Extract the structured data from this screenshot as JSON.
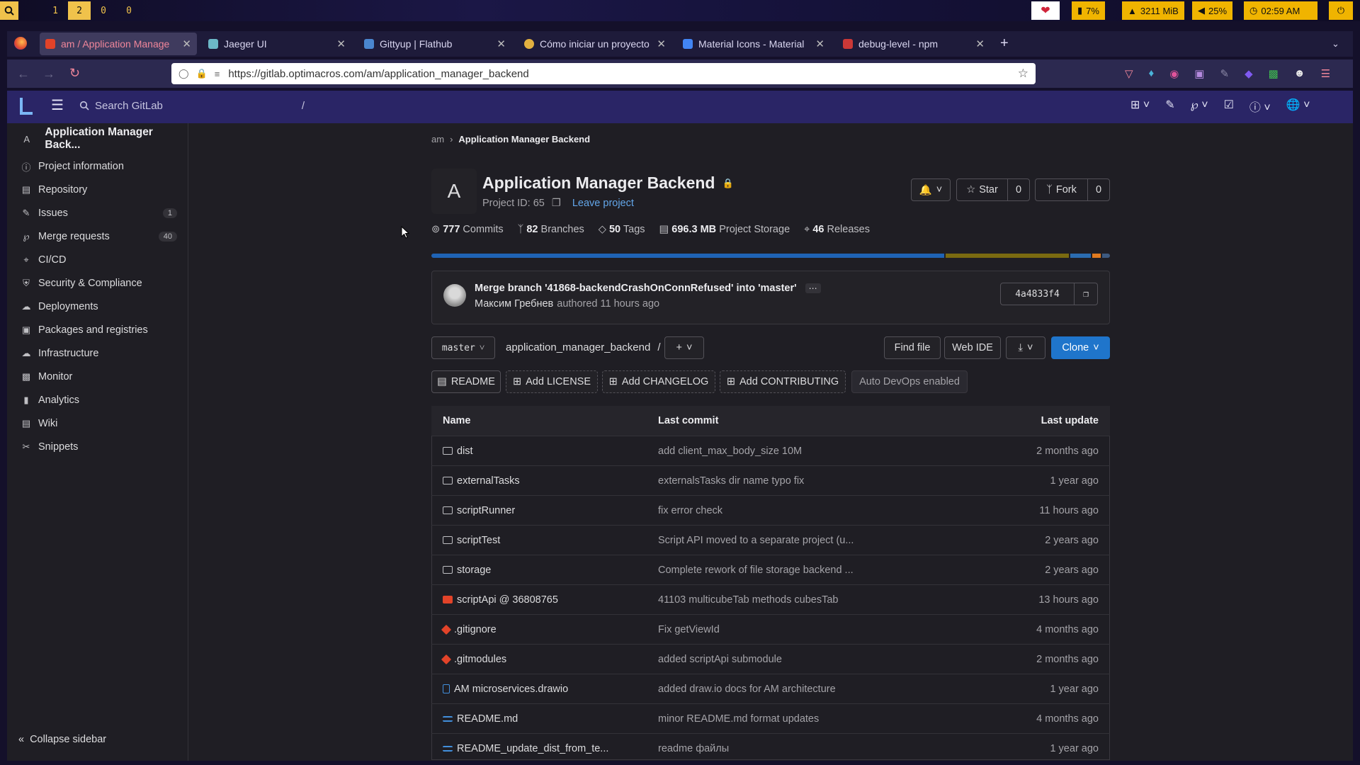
{
  "panel": {
    "workspaces": [
      "1",
      "2",
      "0",
      "0"
    ],
    "cpu": "7%",
    "mem": "3211 MiB",
    "volume": "25%",
    "clock": "02:59 AM"
  },
  "browser": {
    "tabs": [
      {
        "label": "am / Application Manage",
        "color": "#e24329"
      },
      {
        "label": "Jaeger UI",
        "color": "#6cb8c7"
      },
      {
        "label": "Gittyup | Flathub",
        "color": "#4a86cf"
      },
      {
        "label": "Cómo iniciar un proyecto",
        "color": "#e2b040"
      },
      {
        "label": "Material Icons - Material",
        "color": "#4285f4"
      },
      {
        "label": "debug-level - npm",
        "color": "#cb3837"
      }
    ],
    "url": "https://gitlab.optimacros.com/am/application_manager_backend"
  },
  "gitlab": {
    "search_placeholder": "Search GitLab",
    "search_shortcut": "/",
    "sidebar": {
      "project_initial": "A",
      "project_name": "Application Manager Back...",
      "items": [
        {
          "label": "Project information",
          "icon": "info-icon"
        },
        {
          "label": "Repository",
          "icon": "doc-icon"
        },
        {
          "label": "Issues",
          "icon": "issues-icon",
          "badge": "1"
        },
        {
          "label": "Merge requests",
          "icon": "merge-icon",
          "badge": "40"
        },
        {
          "label": "CI/CD",
          "icon": "rocket-icon"
        },
        {
          "label": "Security & Compliance",
          "icon": "shield-icon"
        },
        {
          "label": "Deployments",
          "icon": "deploy-icon"
        },
        {
          "label": "Packages and registries",
          "icon": "package-icon"
        },
        {
          "label": "Infrastructure",
          "icon": "cloud-icon"
        },
        {
          "label": "Monitor",
          "icon": "monitor-icon"
        },
        {
          "label": "Analytics",
          "icon": "chart-icon"
        },
        {
          "label": "Wiki",
          "icon": "book-icon"
        },
        {
          "label": "Snippets",
          "icon": "scissors-icon"
        }
      ],
      "collapse_label": "Collapse sidebar"
    },
    "breadcrumb": {
      "parent": "am",
      "current": "Application Manager Backend"
    },
    "project": {
      "avatar": "A",
      "title": "Application Manager Backend",
      "project_id": "Project ID: 65",
      "leave": "Leave project",
      "star_label": "Star",
      "star_count": "0",
      "fork_label": "Fork",
      "fork_count": "0"
    },
    "stats": {
      "commits_num": "777",
      "commits_label": "Commits",
      "branches_num": "82",
      "branches_label": "Branches",
      "tags_num": "50",
      "tags_label": "Tags",
      "storage_num": "696.3 MB",
      "storage_label": "Project Storage",
      "releases_num": "46",
      "releases_label": "Releases"
    },
    "language_bar": [
      {
        "fraction": 0.762,
        "color": "#1f63b5"
      },
      {
        "fraction": 0.183,
        "color": "#7a6a10"
      },
      {
        "fraction": 0.031,
        "color": "#2b6cb0"
      },
      {
        "fraction": 0.012,
        "color": "#e07a1f"
      },
      {
        "fraction": 0.012,
        "color": "#3d5a80"
      }
    ],
    "last_commit": {
      "message": "Merge branch '41868-backendCrashOnConnRefused' into 'master'",
      "author": "Максим Гребнев",
      "authored": "authored 11 hours ago",
      "sha": "4a4833f4"
    },
    "repo_nav": {
      "branch": "master",
      "path": "application_manager_backend",
      "separator": "/",
      "find_file": "Find file",
      "web_ide": "Web IDE",
      "clone": "Clone"
    },
    "shortcuts": {
      "readme": "README",
      "license": "Add LICENSE",
      "changelog": "Add CHANGELOG",
      "contributing": "Add CONTRIBUTING",
      "devops": "Auto DevOps enabled"
    },
    "table": {
      "headers": [
        "Name",
        "Last commit",
        "Last update"
      ],
      "rows": [
        {
          "name": "dist",
          "type": "folder",
          "commit": "add client_max_body_size 10M",
          "updated": "2 months ago"
        },
        {
          "name": "externalTasks",
          "type": "folder",
          "commit": "externalsTasks dir name typo fix",
          "updated": "1 year ago"
        },
        {
          "name": "scriptRunner",
          "type": "folder",
          "commit": "fix error check",
          "updated": "11 hours ago"
        },
        {
          "name": "scriptTest",
          "type": "folder",
          "commit": "Script API moved to a separate project (u...",
          "updated": "2 years ago"
        },
        {
          "name": "storage",
          "type": "folder",
          "commit": "Complete rework of file storage backend ...",
          "updated": "2 years ago"
        },
        {
          "name": "scriptApi @ 36808765",
          "type": "submodule",
          "commit": "41103 multicubeTab methods cubesTab",
          "updated": "13 hours ago"
        },
        {
          "name": ".gitignore",
          "type": "git",
          "commit": "Fix getViewId",
          "updated": "4 months ago"
        },
        {
          "name": ".gitmodules",
          "type": "git",
          "commit": "added scriptApi submodule",
          "updated": "2 months ago"
        },
        {
          "name": "AM microservices.drawio",
          "type": "file",
          "commit": "added draw.io docs for AM architecture",
          "updated": "1 year ago"
        },
        {
          "name": "README.md",
          "type": "md",
          "commit": "minor README.md format updates",
          "updated": "4 months ago"
        },
        {
          "name": "README_update_dist_from_te...",
          "type": "md",
          "commit": "readme файлы",
          "updated": "1 year ago"
        }
      ]
    }
  }
}
